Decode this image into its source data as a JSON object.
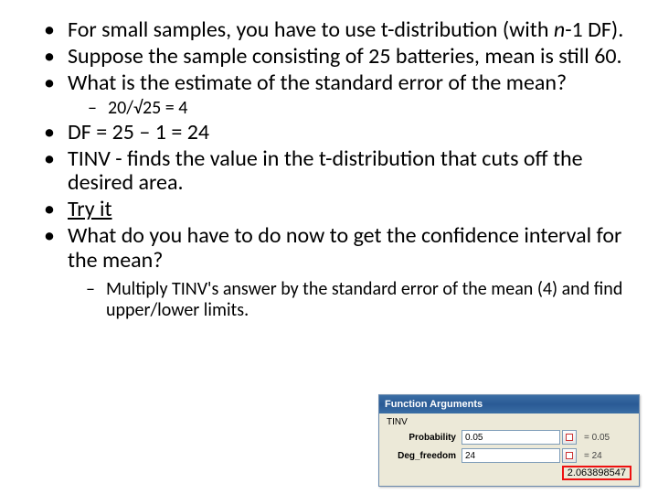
{
  "bullets": {
    "b1a": "For small samples, you have to use t-distribution (with ",
    "b1b": "n",
    "b1c": "-1 DF).",
    "b2": "Suppose the sample consisting of 25 batteries, mean is still 60.",
    "b3": "What is the estimate of the standard error of the mean?",
    "b3_sub": "20/√25 = 4",
    "b4": "DF = 25 – 1 = 24",
    "b5": "TINV - finds the value in the t-distribution that cuts off the desired area.",
    "b6": "Try it",
    "b7": "What do you have to do now to get the confidence interval for the mean?",
    "after": "Multiply TINV's answer by the standard error of the mean (4) and find upper/lower limits."
  },
  "dialog": {
    "title": "Function Arguments",
    "func": "TINV",
    "rows": {
      "prob_label": "Probability",
      "prob_value": "0.05",
      "prob_eval": "= 0.05",
      "df_label": "Deg_freedom",
      "df_value": "24",
      "df_eval": "= 24"
    },
    "result": "2.063898547"
  }
}
